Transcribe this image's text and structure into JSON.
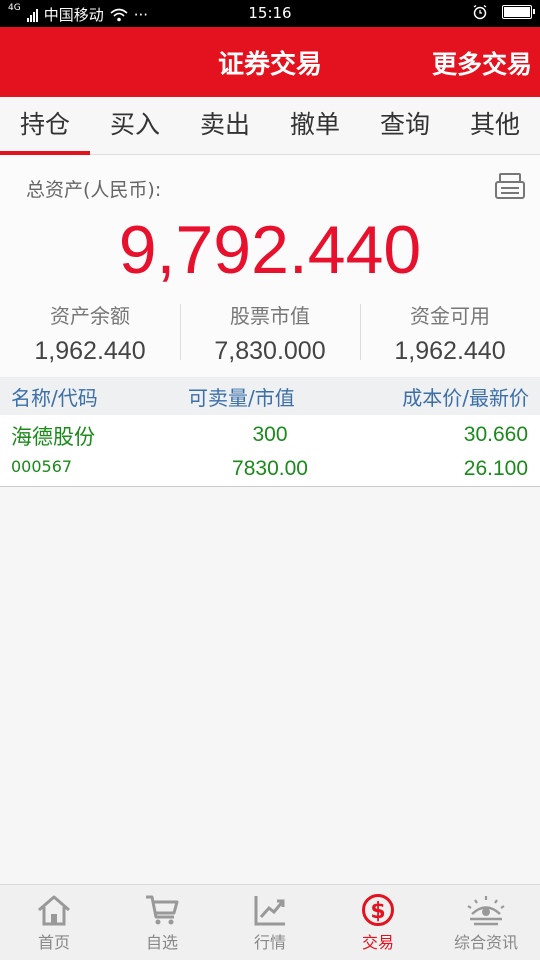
{
  "statusbar": {
    "network": "4G",
    "carrier": "中国移动",
    "more": "···",
    "time": "15:16"
  },
  "header": {
    "title": "证券交易",
    "more_label": "更多交易"
  },
  "tabs": [
    "持仓",
    "买入",
    "卖出",
    "撤单",
    "查询",
    "其他"
  ],
  "active_tab": "持仓",
  "assets": {
    "label": "总资产(人民币):",
    "total": "9,792.440",
    "summary": [
      {
        "title": "资产余额",
        "value": "1,962.440"
      },
      {
        "title": "股票市值",
        "value": "7,830.000"
      },
      {
        "title": "资金可用",
        "value": "1,962.440"
      }
    ]
  },
  "table": {
    "headers": [
      "名称/代码",
      "可卖量/市值",
      "成本价/最新价"
    ],
    "rows": [
      {
        "name": "海德股份",
        "code": "000567",
        "sellable": "300",
        "market_value": "7830.00",
        "cost_price": "30.660",
        "latest_price": "26.100"
      }
    ]
  },
  "bottom_nav": [
    {
      "label": "首页",
      "icon": "home-icon"
    },
    {
      "label": "自选",
      "icon": "cart-icon"
    },
    {
      "label": "行情",
      "icon": "chart-trend-icon"
    },
    {
      "label": "交易",
      "icon": "dollar-circle-icon"
    },
    {
      "label": "综合资讯",
      "icon": "sunrise-eye-icon"
    }
  ],
  "active_nav": "交易",
  "colors": {
    "brand_red": "#e4121f",
    "total_red": "#e8112d",
    "gain_green": "#1a8a1a",
    "header_blue": "#3c6fa8"
  }
}
